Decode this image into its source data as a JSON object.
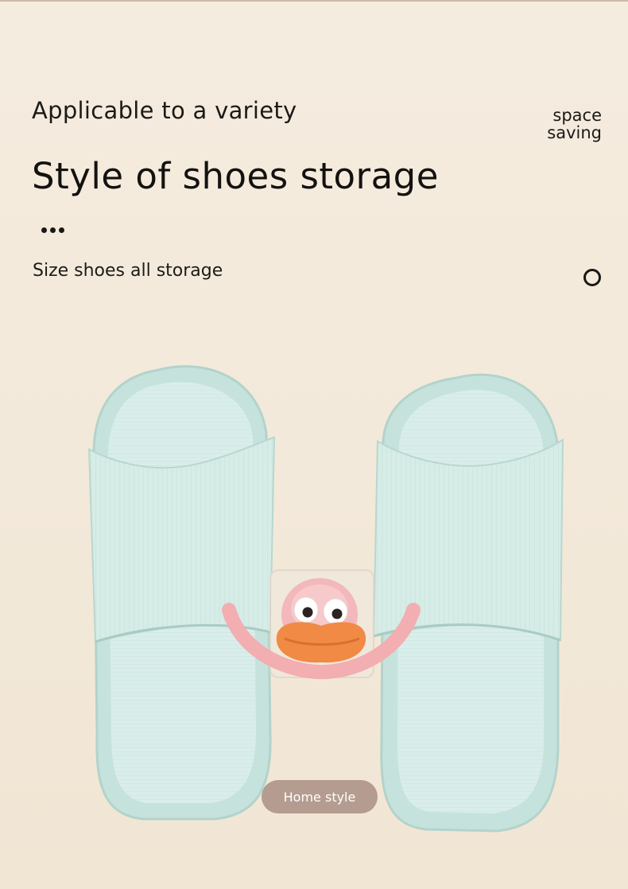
{
  "header": {
    "subtitle": "Applicable to a variety",
    "title": "Style of shoes storage",
    "caption": "Size shoes all storage"
  },
  "corner_note": {
    "line1": "space",
    "line2": "saving"
  },
  "badge": {
    "label": "Home style"
  },
  "colors": {
    "background": "#f3e9da",
    "slipper": "#d4ebe6",
    "hook_pink": "#f2aeb1",
    "mascot_orange": "#f08a45",
    "badge": "#b49c90"
  },
  "icons": [
    "ellipsis-dots-icon",
    "ring-icon"
  ]
}
